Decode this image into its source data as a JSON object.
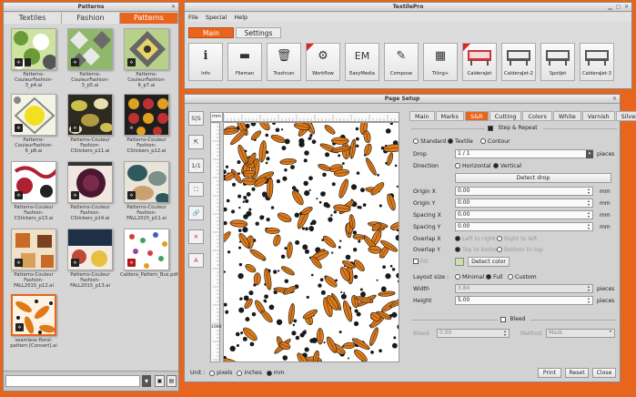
{
  "patterns_window": {
    "title": "Patterns",
    "tabs": [
      {
        "label": "Textiles",
        "active": false
      },
      {
        "label": "Fashion",
        "active": false
      },
      {
        "label": "Patterns",
        "active": true
      }
    ],
    "items": [
      {
        "caption": "Patterns-CouleurFashion-3_p4.ai",
        "badge": "ai"
      },
      {
        "caption": "Patterns-CouleurFashion-3_p5.ai",
        "badge": "ai"
      },
      {
        "caption": "Patterns-CouleurFashion-6_p7.ai",
        "badge": "ai"
      },
      {
        "caption": "Patterns-CouleurFashion-6_p8.ai",
        "badge": "ai"
      },
      {
        "caption": "Patterns-Couleur Fashion-CStickers_p11.ai",
        "badge": "ai"
      },
      {
        "caption": "Patterns-Couleur Fashion-CStickers_p12.ai",
        "badge": "ai"
      },
      {
        "caption": "Patterns-Couleur Fashion-CStickers_p13.ai",
        "badge": "ai"
      },
      {
        "caption": "Patterns-Couleur Fashion-CStickers_p14.ai",
        "badge": "ai"
      },
      {
        "caption": "Patterns-Couleur Fashion-FALL2015_p11.ai",
        "badge": "ai"
      },
      {
        "caption": "Patterns-Couleur Fashion-FALL2015_p12.ai",
        "badge": "ai"
      },
      {
        "caption": "Patterns-Couleur Fashion-FALL2015_p13.ai",
        "badge": "ai"
      },
      {
        "caption": "Caldera_Pattern_Bus.pdf",
        "badge": "pdf"
      },
      {
        "caption": "seamless-floral-pattern [Convert].ai",
        "badge": "ai",
        "selected": true
      }
    ]
  },
  "textilepro": {
    "title": "TextilePro",
    "menu": [
      "File",
      "Special",
      "Help"
    ],
    "tabs": [
      {
        "label": "Main",
        "active": true
      },
      {
        "label": "Settings",
        "active": false
      }
    ],
    "tools": [
      {
        "label": "Info",
        "icon": "info-icon",
        "glyph": "i"
      },
      {
        "label": "Fileman",
        "icon": "folder-icon",
        "glyph": "▬"
      },
      {
        "label": "Trashcan",
        "icon": "trash-icon",
        "glyph": "🗑"
      },
      {
        "label": "Workflow",
        "icon": "gear-icon",
        "glyph": "⚙"
      },
      {
        "label": "EasyMedia",
        "icon": "easymedia-icon",
        "glyph": "EM"
      },
      {
        "label": "Compose",
        "icon": "compose-icon",
        "glyph": "✎"
      },
      {
        "label": "Tiling+",
        "icon": "tiling-icon",
        "glyph": "▦"
      },
      {
        "label": "CalderaJet",
        "icon": "printer-icon",
        "glyph": ""
      },
      {
        "label": "CalderaJet-2",
        "icon": "printer-icon",
        "glyph": ""
      },
      {
        "label": "SpotJet",
        "icon": "printer-icon",
        "glyph": ""
      },
      {
        "label": "CalderaJet-3",
        "icon": "printer-icon",
        "glyph": ""
      }
    ]
  },
  "page_setup": {
    "title": "Page Setup",
    "left_tools": [
      "S|S",
      "⇱",
      "1/1",
      "⛶",
      "🔗",
      "✕",
      "A"
    ],
    "ruler_unit": "mm",
    "ruler_left_label": "1000",
    "unit_label": "Unit :",
    "units": [
      {
        "label": "pixels",
        "on": false
      },
      {
        "label": "inches",
        "on": false
      },
      {
        "label": "mm",
        "on": true
      }
    ],
    "tabs": [
      {
        "label": "Main",
        "active": false
      },
      {
        "label": "Marks",
        "active": false
      },
      {
        "label": "S&R",
        "active": true
      },
      {
        "label": "Cutting",
        "active": false
      },
      {
        "label": "Colors",
        "active": false
      },
      {
        "label": "White",
        "active": false
      },
      {
        "label": "Varnish",
        "active": false
      },
      {
        "label": "Silver",
        "active": false
      }
    ],
    "step_repeat": {
      "section_title": "Step & Repeat",
      "modes": [
        {
          "label": "Standard",
          "on": false
        },
        {
          "label": "Textile",
          "on": true
        },
        {
          "label": "Contour",
          "on": false
        }
      ],
      "drop_label": "Drop",
      "drop_value": "1 / 1",
      "drop_unit": "pieces",
      "direction_label": "Direction",
      "direction_options": [
        {
          "label": "Horizontal",
          "on": false
        },
        {
          "label": "Vertical",
          "on": true
        }
      ],
      "detect_drop": "Detect drop",
      "fields": [
        {
          "label": "Origin X",
          "value": "0.00",
          "unit": "mm"
        },
        {
          "label": "Origin Y",
          "value": "0.00",
          "unit": "mm"
        },
        {
          "label": "Spacing X",
          "value": "0.00",
          "unit": "mm"
        },
        {
          "label": "Spacing Y",
          "value": "0.00",
          "unit": "mm"
        }
      ],
      "overlap_x_label": "Overlap X",
      "overlap_x_options": [
        {
          "label": "Left to right",
          "on": true
        },
        {
          "label": "Right to left",
          "on": false
        }
      ],
      "overlap_y_label": "Overlap Y",
      "overlap_y_options": [
        {
          "label": "Top to bottom",
          "on": true
        },
        {
          "label": "Bottom to top",
          "on": false
        }
      ],
      "fill_label": "Fill",
      "detect_color": "Detect color",
      "layout_size_label": "Layout size :",
      "layout_options": [
        {
          "label": "Minimal",
          "on": false
        },
        {
          "label": "Full",
          "on": true
        },
        {
          "label": "Custom",
          "on": false
        }
      ],
      "width_label": "Width",
      "width_value": "3.84",
      "width_unit": "pieces",
      "height_label": "Height",
      "height_value": "5.00",
      "height_unit": "pieces"
    },
    "bleed": {
      "section_title": "Bleed",
      "bleed_label": "Bleed",
      "bleed_value": "0.00",
      "method_label": "Method",
      "method_value": "Mask"
    },
    "buttons": {
      "print": "Print",
      "reset": "Reset",
      "close": "Close"
    }
  },
  "colors": {
    "accent": "#e8651e",
    "pattern_orange": "#e07a18",
    "pattern_dark": "#1a1a1a"
  }
}
